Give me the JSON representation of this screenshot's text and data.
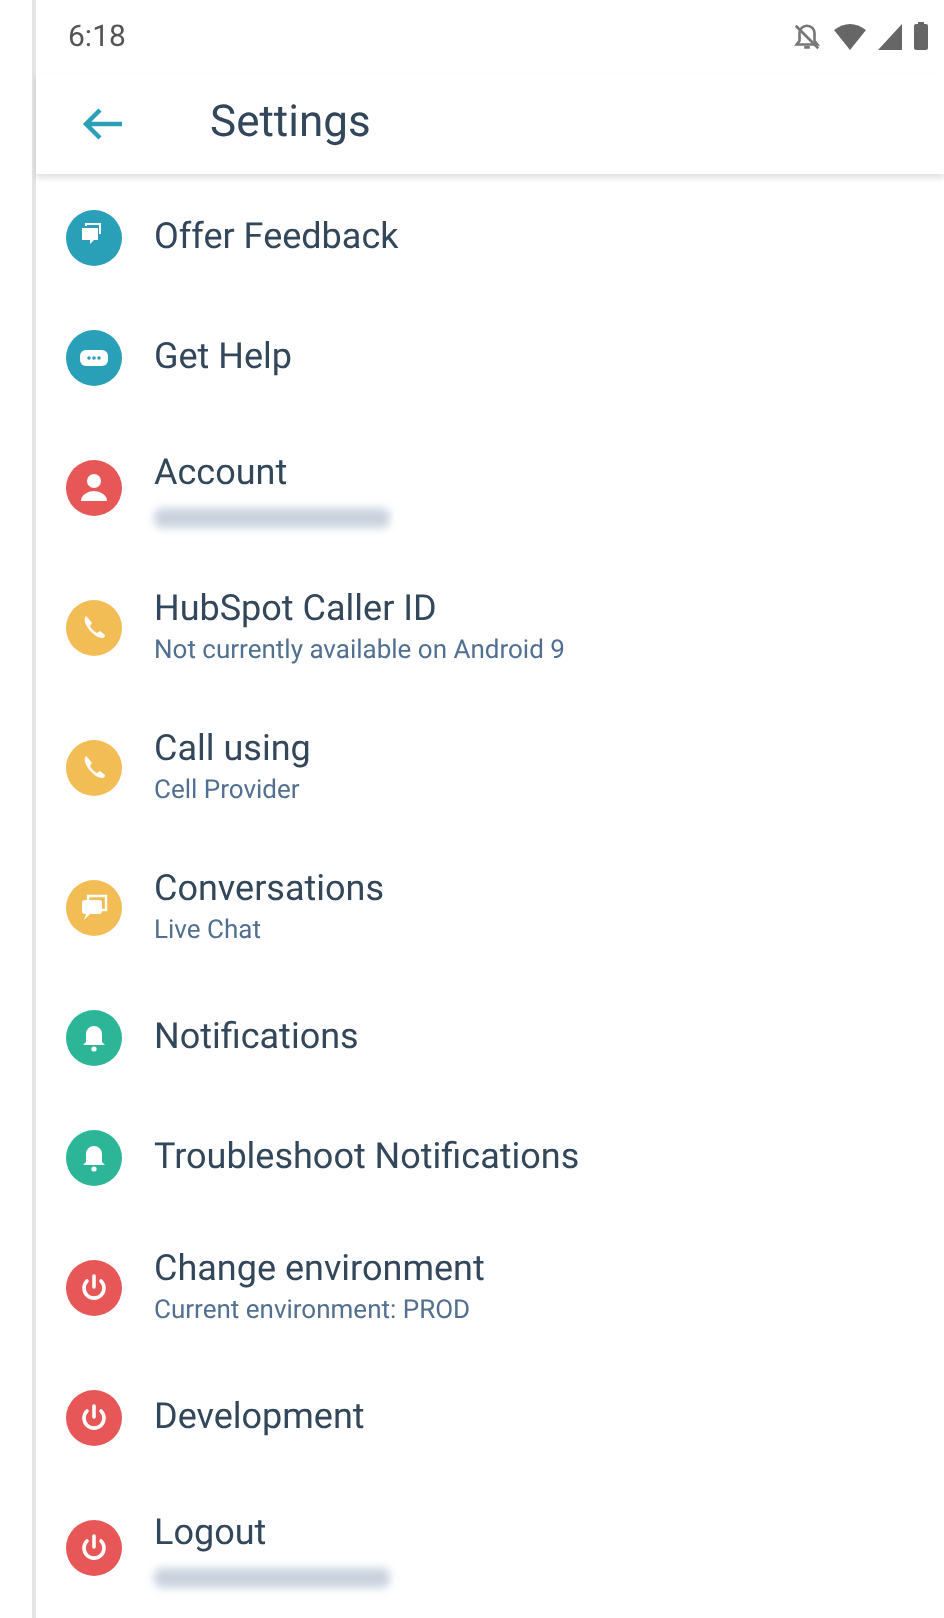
{
  "status_bar": {
    "time": "6:18"
  },
  "app_bar": {
    "title": "Settings"
  },
  "items": [
    {
      "title": "Offer Feedback",
      "kind": "feedback",
      "color": "#2a9fb8"
    },
    {
      "title": "Get Help",
      "kind": "help",
      "color": "#2a9fb8"
    },
    {
      "title": "Account",
      "kind": "person",
      "color": "#e85757",
      "subtitle_redacted": true
    },
    {
      "title": "HubSpot Caller ID",
      "subtitle": "Not currently available on Android 9",
      "kind": "phone",
      "color": "#f2bd55"
    },
    {
      "title": "Call using",
      "subtitle": "Cell Provider",
      "kind": "phone",
      "color": "#f2bd55"
    },
    {
      "title": "Conversations",
      "subtitle": "Live Chat",
      "kind": "chat",
      "color": "#f2bd55"
    },
    {
      "title": "Notifications",
      "kind": "bell",
      "color": "#2db597"
    },
    {
      "title": "Troubleshoot Notifications",
      "kind": "bell",
      "color": "#2db597"
    },
    {
      "title": "Change environment",
      "subtitle": "Current environment: PROD",
      "kind": "power",
      "color": "#e85757"
    },
    {
      "title": "Development",
      "kind": "power",
      "color": "#e85757"
    },
    {
      "title": "Logout",
      "kind": "power",
      "color": "#e85757",
      "subtitle_redacted": true
    }
  ]
}
